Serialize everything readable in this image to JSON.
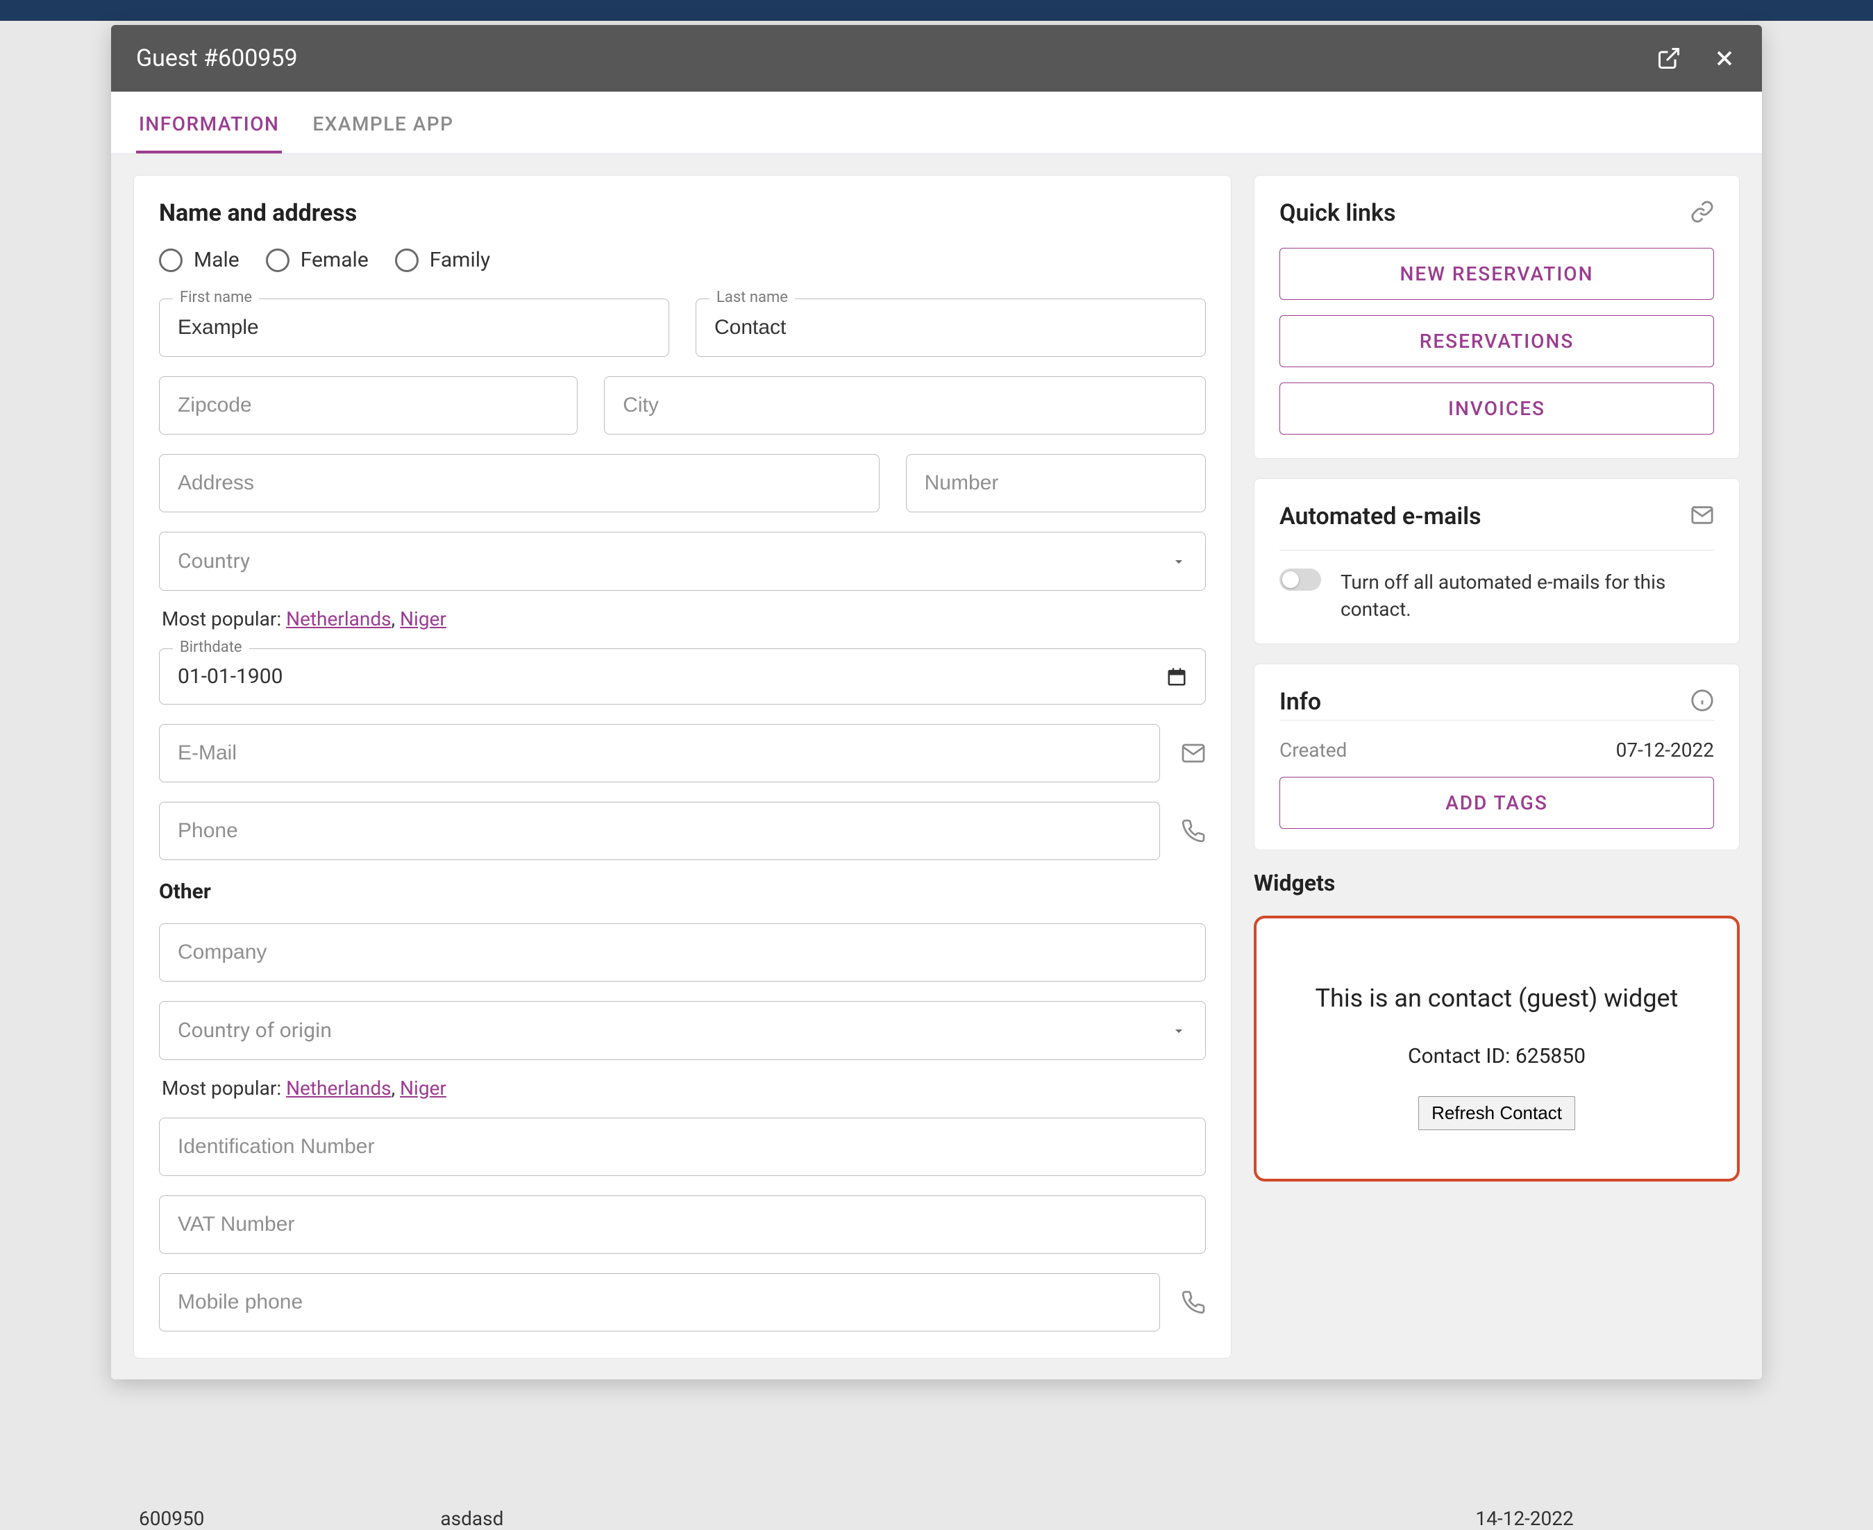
{
  "header": {
    "title": "Guest #600959"
  },
  "tabs": [
    {
      "label": "INFORMATION",
      "active": true
    },
    {
      "label": "EXAMPLE APP",
      "active": false
    }
  ],
  "form": {
    "nameAddressTitle": "Name and address",
    "gender": {
      "male": "Male",
      "female": "Female",
      "family": "Family"
    },
    "firstName": {
      "label": "First name",
      "value": "Example"
    },
    "lastName": {
      "label": "Last name",
      "value": "Contact"
    },
    "zipcode": {
      "placeholder": "Zipcode"
    },
    "city": {
      "placeholder": "City"
    },
    "address": {
      "placeholder": "Address"
    },
    "number": {
      "placeholder": "Number"
    },
    "country": {
      "placeholder": "Country"
    },
    "popularPrefix": "Most popular: ",
    "popularLinks": [
      "Netherlands",
      "Niger"
    ],
    "birthdate": {
      "label": "Birthdate",
      "value": "01-01-1900"
    },
    "email": {
      "placeholder": "E-Mail"
    },
    "phone": {
      "placeholder": "Phone"
    },
    "otherTitle": "Other",
    "company": {
      "placeholder": "Company"
    },
    "countryOrigin": {
      "placeholder": "Country of origin"
    },
    "idNumber": {
      "placeholder": "Identification Number"
    },
    "vatNumber": {
      "placeholder": "VAT Number"
    },
    "mobile": {
      "placeholder": "Mobile phone"
    }
  },
  "quickLinks": {
    "title": "Quick links",
    "buttons": [
      "NEW RESERVATION",
      "RESERVATIONS",
      "INVOICES"
    ]
  },
  "autoEmails": {
    "title": "Automated e-mails",
    "toggleText": "Turn off all automated e-mails for this contact."
  },
  "info": {
    "title": "Info",
    "createdLabel": "Created",
    "createdValue": "07-12-2022",
    "addTags": "ADD TAGS"
  },
  "widgets": {
    "title": "Widgets",
    "heading": "This is an contact (guest) widget",
    "contactIdLabel": "Contact ID: ",
    "contactId": "625850",
    "refresh": "Refresh Contact"
  },
  "bgRow": {
    "id": "600950",
    "name": "asdasd",
    "date": "14-12-2022"
  }
}
